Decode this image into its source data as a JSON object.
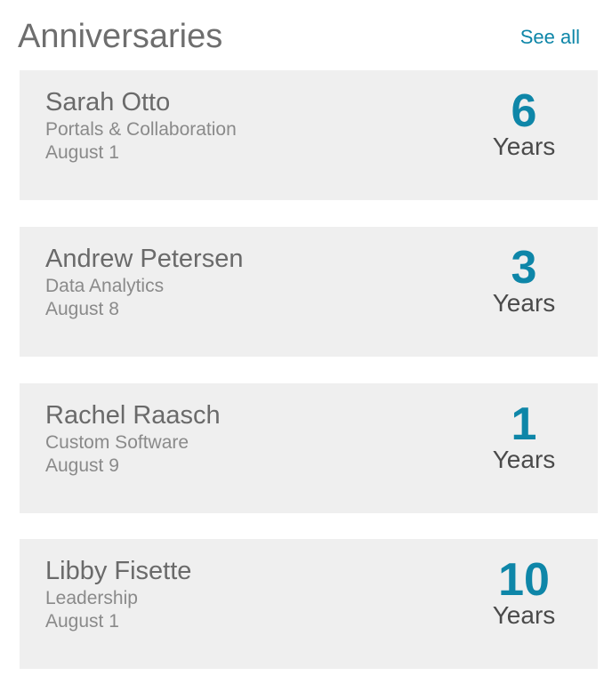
{
  "header": {
    "title": "Anniversaries",
    "see_all_label": "See all"
  },
  "anniversaries": [
    {
      "name": "Sarah Otto",
      "department": "Portals & Collaboration",
      "date": "August 1",
      "years": "6",
      "years_label": "Years"
    },
    {
      "name": "Andrew Petersen",
      "department": "Data Analytics",
      "date": "August 8",
      "years": "3",
      "years_label": "Years"
    },
    {
      "name": "Rachel Raasch",
      "department": "Custom Software",
      "date": "August 9",
      "years": "1",
      "years_label": "Years"
    },
    {
      "name": "Libby Fisette",
      "department": "Leadership",
      "date": "August 1",
      "years": "10",
      "years_label": "Years"
    }
  ],
  "colors": {
    "accent": "#0e86a8",
    "card_background": "#efefef",
    "title_text": "#6e6e6e"
  }
}
